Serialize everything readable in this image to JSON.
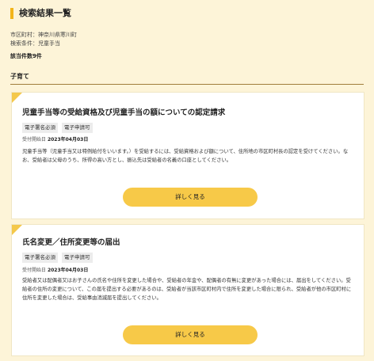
{
  "page_title": "検索結果一覧",
  "meta": {
    "city": "市区町村：神奈川県寒川町",
    "conditions": "検索条件：児童手当"
  },
  "result_count": "該当件数9件",
  "section_title": "子育て",
  "cards": [
    {
      "title": "児童手当等の受給資格及び児童手当の額についての認定請求",
      "tags": [
        "電子署名必須",
        "電子申請可"
      ],
      "date_label": "受付開始日",
      "date_value": "2023年04月03日",
      "description": "児童手当等（児童手当又は特例給付をいいます。）を受給するには、受給資格および額について、住所地の市区町村長の認定を受けてください。なお、受給者は父母のうち、所得の高い方とし、振込先は受給者の名義の口座としてください。",
      "button_label": "詳しく見る"
    },
    {
      "title": "氏名変更／住所変更等の届出",
      "tags": [
        "電子署名必須",
        "電子申請可"
      ],
      "date_label": "受付開始日",
      "date_value": "2023年04月03日",
      "description": "受給者又は配偶者又はお子さんの氏名や住所を変更した場合や、受給者の年金や、配偶者の有無に変更があった場合には、届出をしてください。受給者の住所の変更について、この届を提出する必要があるのは、受給者が当該市区町村内で住所を変更した場合に限られ、受給者が他の市区町村に住所を変更した場合は、受給事由消滅届を提出してください。",
      "button_label": "詳しく見る"
    }
  ]
}
